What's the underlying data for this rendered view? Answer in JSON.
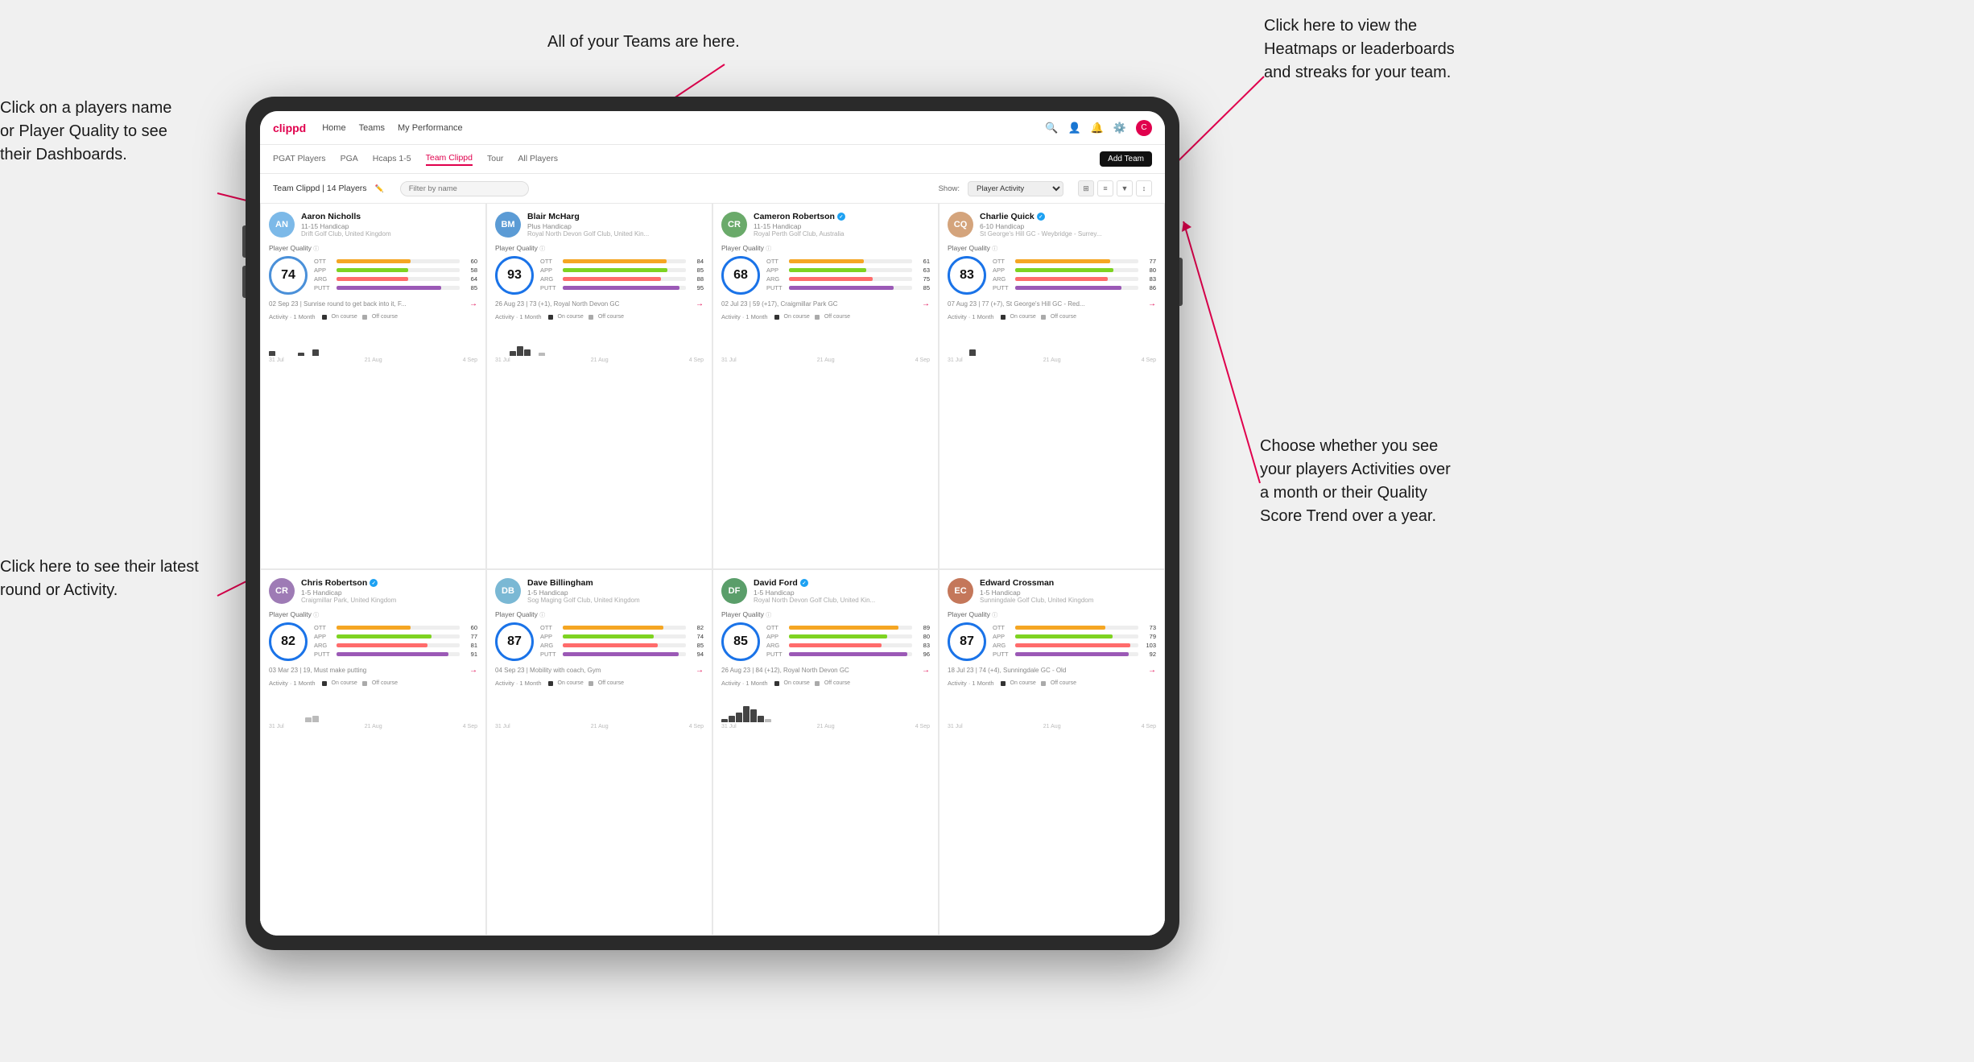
{
  "annotations": {
    "top_center": "All of your Teams are here.",
    "top_right_title": "Click here to view the",
    "top_right_line2": "Heatmaps or leaderboards",
    "top_right_line3": "and streaks for your team.",
    "left_top_title": "Click on a players name",
    "left_top_line2": "or Player Quality to see",
    "left_top_line3": "their Dashboards.",
    "left_bottom_title": "Click here to see their latest",
    "left_bottom_line2": "round or Activity.",
    "right_bottom_title": "Choose whether you see",
    "right_bottom_line2": "your players Activities over",
    "right_bottom_line3": "a month or their Quality",
    "right_bottom_line4": "Score Trend over a year."
  },
  "nav": {
    "logo": "clippd",
    "links": [
      "Home",
      "Teams",
      "My Performance"
    ],
    "active": "Teams"
  },
  "subnav": {
    "tabs": [
      "PGAT Players",
      "PGA",
      "Hcaps 1-5",
      "Team Clippd",
      "Tour",
      "All Players"
    ],
    "active": "Team Clippd",
    "add_team_label": "Add Team"
  },
  "team_header": {
    "title": "Team Clippd | 14 Players",
    "filter_placeholder": "Filter by name",
    "show_label": "Show:",
    "show_value": "Player Activity"
  },
  "players": [
    {
      "name": "Aaron Nicholls",
      "handicap": "11-15 Handicap",
      "club": "Drift Golf Club, United Kingdom",
      "quality": 74,
      "verified": false,
      "ott": 60,
      "app": 58,
      "arg": 64,
      "putt": 85,
      "latest": "02 Sep 23 | Sunrise round to get back into it, F...",
      "color": "#4a90d9",
      "initials": "AN",
      "avatar_bg": "#7cb9e8"
    },
    {
      "name": "Blair McHarg",
      "handicap": "Plus Handicap",
      "club": "Royal North Devon Golf Club, United Kin...",
      "quality": 93,
      "verified": false,
      "ott": 84,
      "app": 85,
      "arg": 88,
      "putt": 95,
      "latest": "26 Aug 23 | 73 (+1), Royal North Devon GC",
      "color": "#1a73e8",
      "initials": "BM",
      "avatar_bg": "#5b9bd5"
    },
    {
      "name": "Cameron Robertson",
      "handicap": "11-15 Handicap",
      "club": "Royal Perth Golf Club, Australia",
      "quality": 68,
      "verified": true,
      "ott": 61,
      "app": 63,
      "arg": 75,
      "putt": 85,
      "latest": "02 Jul 23 | 59 (+17), Craigmillar Park GC",
      "color": "#1a73e8",
      "initials": "CR",
      "avatar_bg": "#6aaa6a"
    },
    {
      "name": "Charlie Quick",
      "handicap": "6-10 Handicap",
      "club": "St George's Hill GC - Weybridge - Surrey...",
      "quality": 83,
      "verified": true,
      "ott": 77,
      "app": 80,
      "arg": 83,
      "putt": 86,
      "latest": "07 Aug 23 | 77 (+7), St George's Hill GC - Red...",
      "color": "#1a73e8",
      "initials": "CQ",
      "avatar_bg": "#d4a47c"
    },
    {
      "name": "Chris Robertson",
      "handicap": "1-5 Handicap",
      "club": "Craigmillar Park, United Kingdom",
      "quality": 82,
      "verified": true,
      "ott": 60,
      "app": 77,
      "arg": 81,
      "putt": 91,
      "latest": "03 Mar 23 | 19, Must make putting",
      "color": "#1a73e8",
      "initials": "CR",
      "avatar_bg": "#9e7bb5"
    },
    {
      "name": "Dave Billingham",
      "handicap": "1-5 Handicap",
      "club": "Sog Maging Golf Club, United Kingdom",
      "quality": 87,
      "verified": false,
      "ott": 82,
      "app": 74,
      "arg": 85,
      "putt": 94,
      "latest": "04 Sep 23 | Mobility with coach, Gym",
      "color": "#1a73e8",
      "initials": "DB",
      "avatar_bg": "#7ab8d4"
    },
    {
      "name": "David Ford",
      "handicap": "1-5 Handicap",
      "club": "Royal North Devon Golf Club, United Kin...",
      "quality": 85,
      "verified": true,
      "ott": 89,
      "app": 80,
      "arg": 83,
      "putt": 96,
      "latest": "26 Aug 23 | 84 (+12), Royal North Devon GC",
      "color": "#1a73e8",
      "initials": "DF",
      "avatar_bg": "#5a9e6a"
    },
    {
      "name": "Edward Crossman",
      "handicap": "1-5 Handicap",
      "club": "Sunningdale Golf Club, United Kingdom",
      "quality": 87,
      "verified": false,
      "ott": 73,
      "app": 79,
      "arg": 103,
      "putt": 92,
      "latest": "18 Jul 23 | 74 (+4), Sunningdale GC - Old",
      "color": "#1a73e8",
      "initials": "EC",
      "avatar_bg": "#c4775a"
    }
  ],
  "activity": {
    "label": "Activity · 1 Month",
    "on_course": "On course",
    "off_course": "Off course",
    "dates": [
      "31 Jul",
      "21 Aug",
      "4 Sep"
    ]
  }
}
